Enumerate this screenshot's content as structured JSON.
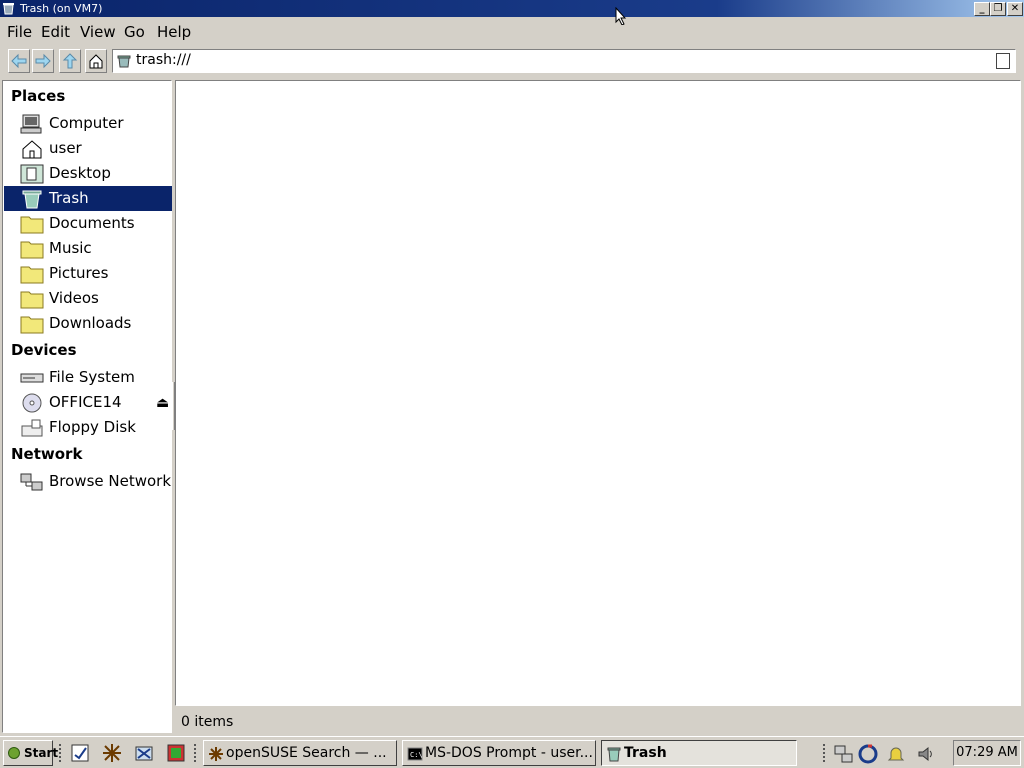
{
  "window": {
    "title": "Trash (on VM7)",
    "minimize": "_",
    "maximize": "❐",
    "close": "✕"
  },
  "menu": [
    "File",
    "Edit",
    "View",
    "Go",
    "Help"
  ],
  "location": {
    "path": "trash:///"
  },
  "sidebar": {
    "places_title": "Places",
    "places": [
      {
        "label": "Computer",
        "icon": "computer-icon"
      },
      {
        "label": "user",
        "icon": "home-icon"
      },
      {
        "label": "Desktop",
        "icon": "desktop-icon"
      },
      {
        "label": "Trash",
        "icon": "trash-icon",
        "selected": true
      },
      {
        "label": "Documents",
        "icon": "folder-icon"
      },
      {
        "label": "Music",
        "icon": "folder-icon"
      },
      {
        "label": "Pictures",
        "icon": "folder-icon"
      },
      {
        "label": "Videos",
        "icon": "folder-icon"
      },
      {
        "label": "Downloads",
        "icon": "folder-icon"
      }
    ],
    "devices_title": "Devices",
    "devices": [
      {
        "label": "File System",
        "icon": "drive-icon"
      },
      {
        "label": "OFFICE14",
        "icon": "cdrom-icon",
        "eject": "⏏"
      },
      {
        "label": "Floppy Disk",
        "icon": "floppy-icon"
      }
    ],
    "network_title": "Network",
    "network": [
      {
        "label": "Browse Network",
        "icon": "network-icon"
      }
    ]
  },
  "status": {
    "text": "0 items"
  },
  "taskbar": {
    "start": "Start",
    "tasks": [
      {
        "label": "openSUSE Search — ...",
        "icon": "search-app-icon"
      },
      {
        "label": "MS-DOS Prompt - user...",
        "icon": "terminal-icon"
      },
      {
        "label": "Trash",
        "icon": "trash-icon",
        "active": true
      }
    ],
    "clock": "07:29 AM"
  },
  "colors": {
    "selection": "#0a246a",
    "titlebar": "#0a246a",
    "folder": "#f2e87a"
  }
}
